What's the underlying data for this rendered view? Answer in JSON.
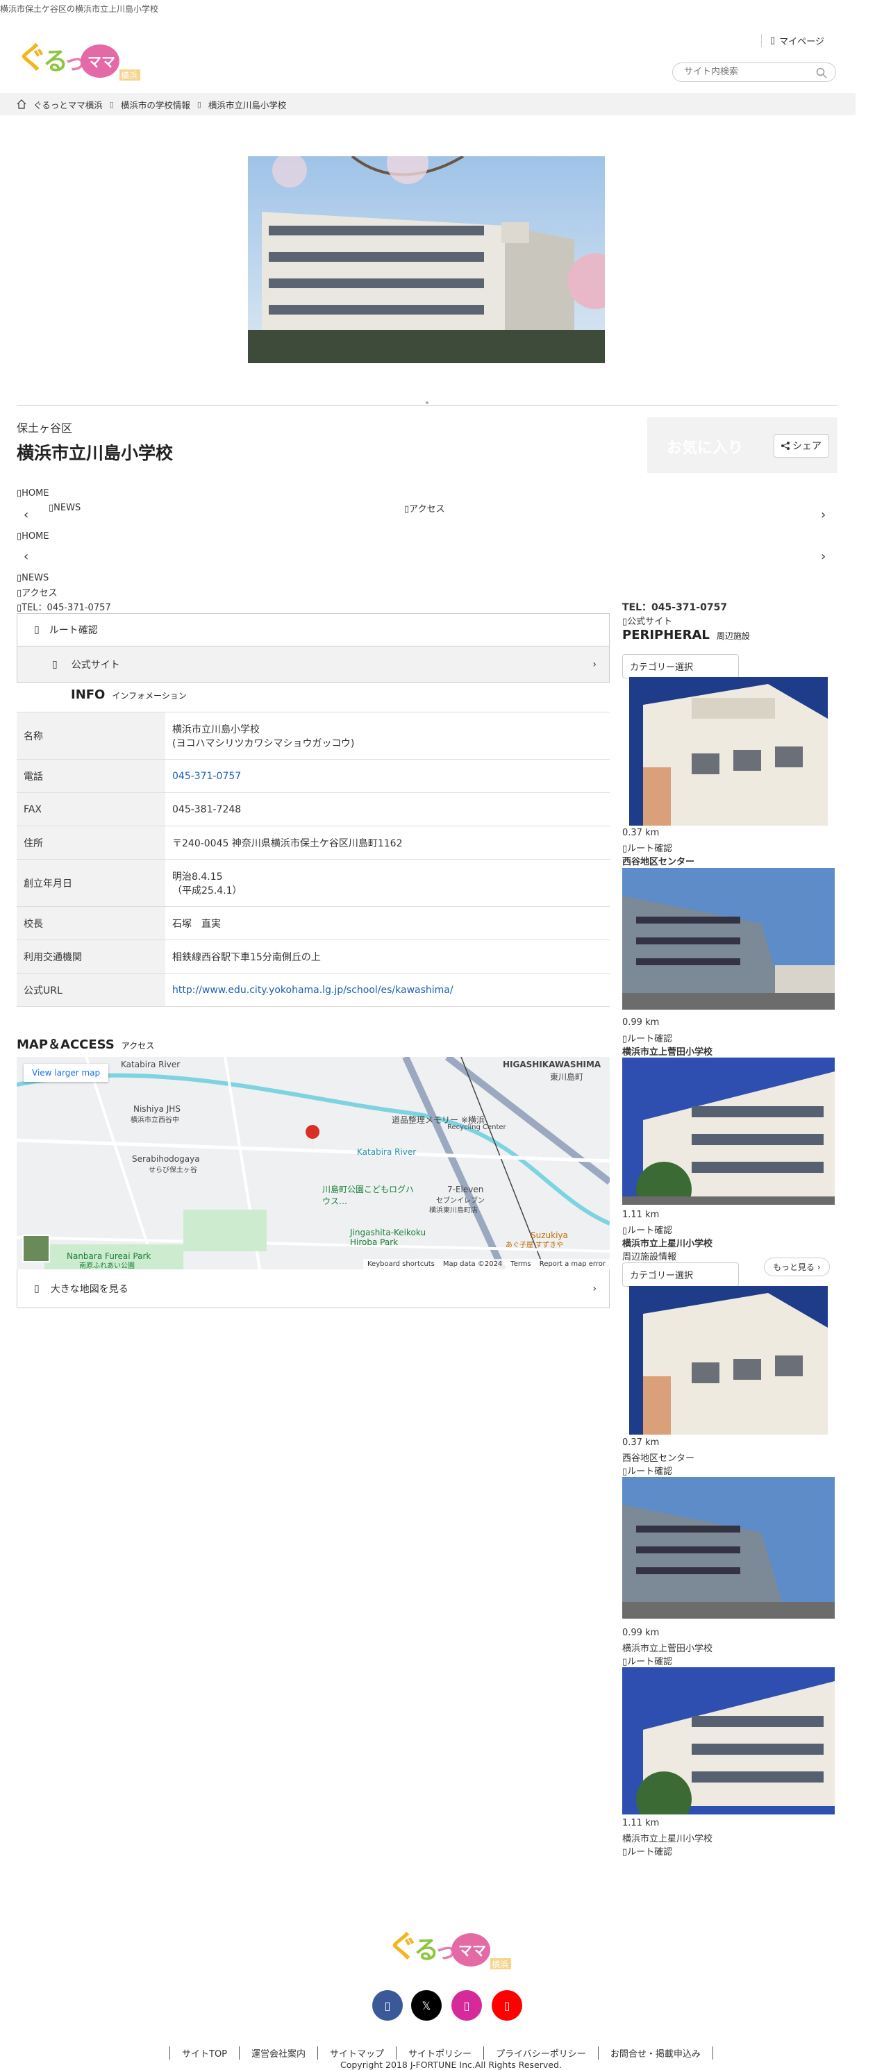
{
  "head": {
    "top_tag": "横浜市保土ケ谷区の横浜市立上川島小学校",
    "mypage": "マイページ",
    "search_placeholder": "サイト内検索"
  },
  "breadcrumb": {
    "home": "ぐるっとママ横浜",
    "parent": "横浜市の学校情報",
    "current": "横浜市立川島小学校"
  },
  "school": {
    "area": "保土ヶ谷区",
    "name": "横浜市立川島小学校",
    "favorite": "お気に入り",
    "share": "シェア"
  },
  "tabs": {
    "home": "HOME",
    "news": "NEWS",
    "access": "アクセス",
    "tel": "TEL：045-371-0757"
  },
  "actions": {
    "route": "ルート確認",
    "official": "公式サイト",
    "larger_map": "大きな地図を見る",
    "more": "もっと見る"
  },
  "info": {
    "heading": "INFO",
    "heading_sub": "インフォメーション",
    "rows": [
      {
        "k": "名称",
        "v": "横浜市立川島小学校",
        "v2": "(ヨコハマシリツカワシマショウガッコウ)"
      },
      {
        "k": "電話",
        "v": "045-371-0757"
      },
      {
        "k": "FAX",
        "v": "045-381-7248"
      },
      {
        "k": "住所",
        "v": "〒240-0045 神奈川県横浜市保土ケ谷区川島町1162"
      },
      {
        "k": "創立年月日",
        "v": "明治8.4.15",
        "v2": "（平成25.4.1）"
      },
      {
        "k": "校長",
        "v": "石塚　直実"
      },
      {
        "k": "利用交通機関",
        "v": "相鉄線西谷駅下車15分南側丘の上"
      },
      {
        "k": "公式URL",
        "v": "http://www.edu.city.yokohama.lg.jp/school/es/kawashima/"
      }
    ]
  },
  "map": {
    "heading": "MAP＆ACCESS",
    "heading_sub": "アクセス",
    "larger": "View larger map",
    "labels": [
      "Katabira River",
      "HIGASHIKAWASHIMA",
      "東川島町",
      "Nishiya JHS",
      "横浜市立西谷中",
      "Serabihodogaya",
      "せらび保土ヶ谷",
      "道品整理メモリー ※横浜",
      "Recycling Center",
      "Katabira River",
      "川島町公園こどもログハウス…",
      "7-Eleven",
      "セブンイレブン",
      "横浜東川島町店",
      "Jingashita-Keikoku Hiroba Park",
      "Nanbara Fureai Park",
      "南原ふれあい公園",
      "Suzukiya",
      "あぐ子屋 すずきや"
    ],
    "footer": [
      "Keyboard shortcuts",
      "Map data ©2024",
      "Terms",
      "Report a map error"
    ]
  },
  "side": {
    "tel": "TEL：045-371-0757",
    "official": "公式サイト",
    "peripheral": "PERIPHERAL",
    "peripheral_sub": "周辺施設",
    "category": "カテゴリー選択",
    "nearby_label": "周辺施設情報",
    "items": [
      {
        "dist": "0.37 km",
        "route": "ルート確認",
        "name": "西谷地区センター"
      },
      {
        "dist": "0.99 km",
        "route": "ルート確認",
        "name": "横浜市立上菅田小学校"
      },
      {
        "dist": "1.11 km",
        "route": "ルート確認",
        "name": "横浜市立上星川小学校"
      }
    ]
  },
  "footer": {
    "nav": [
      "サイトTOP",
      "運営会社案内",
      "サイトマップ",
      "サイトポリシー",
      "プライバシーポリシー",
      "お問合せ・掲載申込み"
    ],
    "copyright": "Copyright 2018 J-FORTUNE Inc.All Rights Reserved.",
    "social": [
      "facebook-icon",
      "x-icon",
      "instagram-icon",
      "youtube-icon"
    ]
  },
  "colors": {
    "link": "#1a5fb4",
    "fb": "#3b5998",
    "x": "#000000",
    "insta": "#d62a9b",
    "yt": "#ff0000"
  }
}
